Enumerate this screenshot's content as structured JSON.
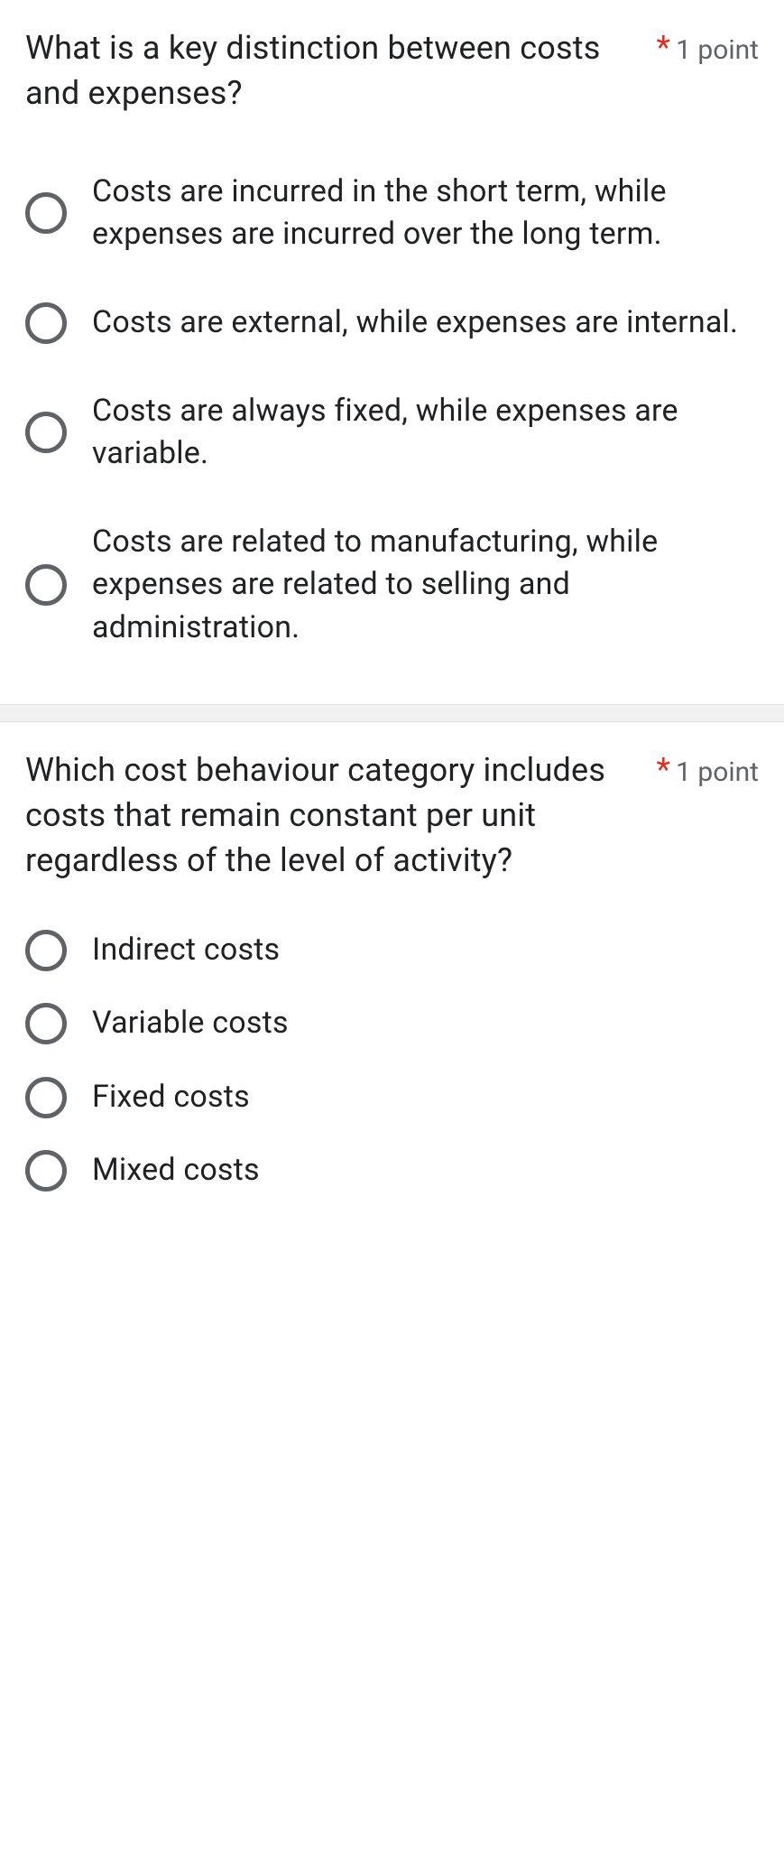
{
  "required_marker": "*",
  "questions": [
    {
      "text": "What is a key distinction between costs and expenses?",
      "points": "1 point",
      "options": [
        "Costs are incurred in the short term, while expenses are incurred over the long term.",
        "Costs are external, while expenses are internal.",
        "Costs are always fixed, while expenses are variable.",
        "Costs are related to manufacturing, while expenses are related to selling and administration."
      ]
    },
    {
      "text": "Which cost behaviour category includes costs that remain constant per unit regardless of the level of activity?",
      "points": "1 point",
      "options": [
        "Indirect costs",
        "Variable costs",
        "Fixed costs",
        "Mixed costs"
      ]
    }
  ]
}
